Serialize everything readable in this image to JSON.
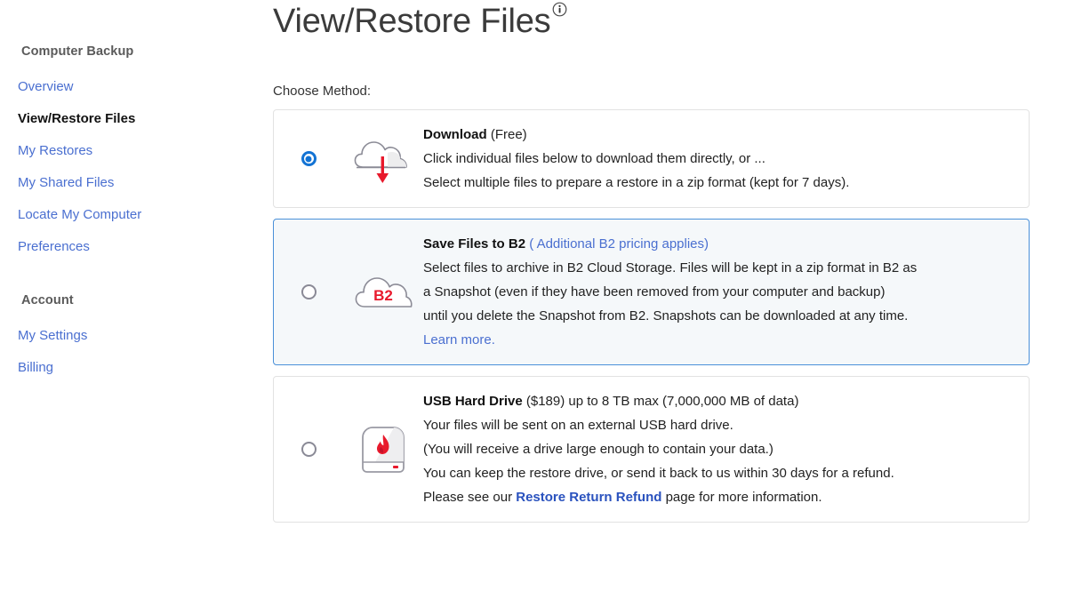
{
  "sidebar": {
    "groups": [
      {
        "title": "Computer Backup",
        "items": [
          {
            "label": "Overview",
            "active": false
          },
          {
            "label": "View/Restore Files",
            "active": true
          },
          {
            "label": "My Restores",
            "active": false
          },
          {
            "label": "My Shared Files",
            "active": false
          },
          {
            "label": "Locate My Computer",
            "active": false
          },
          {
            "label": "Preferences",
            "active": false
          }
        ]
      },
      {
        "title": "Account",
        "items": [
          {
            "label": "My Settings",
            "active": false
          },
          {
            "label": "Billing",
            "active": false
          }
        ]
      }
    ]
  },
  "main": {
    "page_title": "View/Restore Files",
    "info_icon": "info-icon",
    "choose_method_label": "Choose Method:",
    "options": [
      {
        "id": "download",
        "icon": "cloud-download-icon",
        "selected": true,
        "heading": "Download",
        "heading_suffix": " (Free)",
        "lines": [
          "Click individual files below to download them directly, or ...",
          "Select multiple files to prepare a restore in a zip format (kept for 7 days)."
        ]
      },
      {
        "id": "b2",
        "icon": "cloud-b2-icon",
        "icon_label": "B2",
        "selected": false,
        "highlighted": true,
        "heading": "Save Files to B2",
        "heading_link": " ( Additional B2 pricing applies)",
        "lines": [
          "Select files to archive in B2 Cloud Storage. Files will be kept in a zip format in B2 as",
          "a Snapshot (even if they have been removed from your computer and backup)",
          "until you delete the Snapshot from B2. Snapshots can be downloaded at any time."
        ],
        "learn_more": "Learn more."
      },
      {
        "id": "usb",
        "icon": "usb-hard-drive-icon",
        "selected": false,
        "heading": "USB Hard Drive",
        "heading_suffix": " ($189) up to 8 TB max (7,000,000 MB of data)",
        "lines": [
          "Your files will be sent on an external USB hard drive.",
          "(You will receive a drive large enough to contain your data.)",
          "You can keep the restore drive, or send it back to us within 30 days for a refund."
        ],
        "footer_prefix": "Please see our ",
        "footer_link": "Restore Return Refund",
        "footer_suffix": " page for more information."
      }
    ]
  },
  "colors": {
    "link": "#4a6fd0",
    "link_bold": "#2a52be",
    "accent_red": "#e8192c",
    "radio_selected": "#1373d4",
    "highlight_border": "#4a90d9",
    "highlight_bg": "#f5f8fa"
  }
}
